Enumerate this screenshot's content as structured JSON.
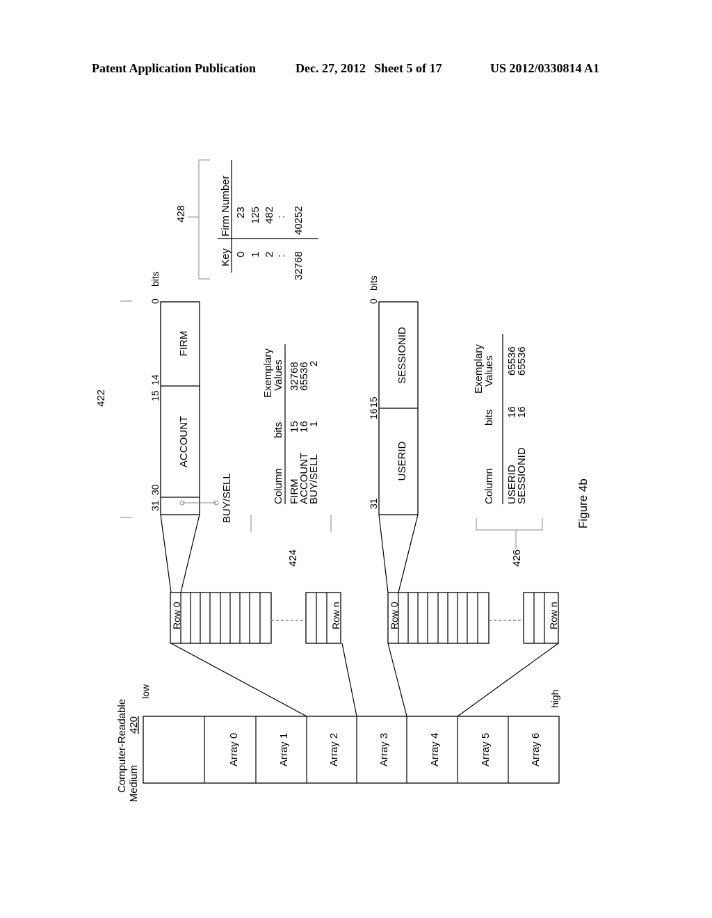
{
  "header": {
    "publication": "Patent Application Publication",
    "date": "Dec. 27, 2012",
    "sheet": "Sheet 5 of 17",
    "number": "US 2012/0330814 A1"
  },
  "figure": {
    "caption": "Figure 4b",
    "medium": {
      "label_line1": "Computer-Readable",
      "label_line2": "Medium",
      "ref": "420",
      "low_label": "low",
      "high_label": "high",
      "arrays": [
        "",
        "Array 0",
        "Array 1",
        "Array 2",
        "Array 3",
        "Array 4",
        "Array 5",
        "Array 6"
      ]
    },
    "row_groups": [
      {
        "first_row": "Row 0",
        "last_row": "Row n"
      },
      {
        "first_row": "Row 0",
        "last_row": "Row n"
      }
    ],
    "layout_422": {
      "ref": "422",
      "bits_unit": "bits",
      "fields": [
        {
          "name": "FIRM",
          "high_bit": "14",
          "low_bit": "0"
        },
        {
          "name": "ACCOUNT",
          "high_bit": "30",
          "low_bit": "15"
        },
        {
          "name": "",
          "high_bit": "31",
          "low_bit": ""
        }
      ],
      "bit_labels": {
        "b0": "0",
        "b14": "14",
        "b15": "15",
        "b30": "30",
        "b31": "31"
      },
      "buy_sell_callout": "BUY/SELL"
    },
    "table_424": {
      "ref": "424",
      "headers": [
        "Column",
        "bits",
        "Exemplary",
        "Values"
      ],
      "rows": [
        {
          "column": "FIRM",
          "bits": "15",
          "value": "32768"
        },
        {
          "column": "ACCOUNT",
          "bits": "16",
          "value": "65536"
        },
        {
          "column": "BUY/SELL",
          "bits": "1",
          "value": "2"
        }
      ]
    },
    "layout_426_record": {
      "bits_unit": "bits",
      "fields": [
        {
          "name": "SESSIONID",
          "high_bit": "15",
          "low_bit": "0"
        },
        {
          "name": "USERID",
          "high_bit": "31",
          "low_bit": "16"
        }
      ],
      "bit_labels": {
        "b0": "0",
        "b15": "15",
        "b16": "16",
        "b31": "31"
      }
    },
    "table_426": {
      "ref": "426",
      "headers": [
        "Column",
        "bits",
        "Exemplary",
        "Values"
      ],
      "rows": [
        {
          "column": "USERID",
          "bits": "16",
          "value": "65536"
        },
        {
          "column": "SESSIONID",
          "bits": "16",
          "value": "65536"
        }
      ]
    },
    "table_428": {
      "ref": "428",
      "headers": [
        "Key",
        "Firm Number"
      ],
      "rows": [
        {
          "key": "0",
          "firm": "23"
        },
        {
          "key": "1",
          "firm": "125"
        },
        {
          "key": "2",
          "firm": "482"
        },
        {
          "key": ":",
          "firm": ":"
        },
        {
          "key": "32768",
          "firm": "40252"
        }
      ]
    }
  }
}
